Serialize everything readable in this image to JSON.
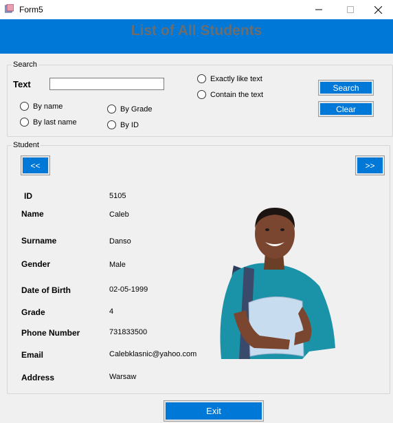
{
  "window": {
    "title": "Form5"
  },
  "header": {
    "title": "List of All Students"
  },
  "search": {
    "group_label": "Search",
    "text_label": "Text",
    "text_value": "",
    "options": {
      "by_name": "By name",
      "by_last_name": "By last name",
      "by_grade": "By Grade",
      "by_id": "By ID",
      "exactly": "Exactly like text",
      "contains": "Contain the text"
    },
    "search_label": "Search",
    "clear_label": "Clear"
  },
  "student": {
    "group_label": "Student",
    "prev_label": "<<",
    "next_label": ">>",
    "fields": {
      "id": {
        "label": "ID",
        "value": "5105"
      },
      "name": {
        "label": "Name",
        "value": "Caleb"
      },
      "surname": {
        "label": "Surname",
        "value": "Danso"
      },
      "gender": {
        "label": "Gender",
        "value": "Male"
      },
      "dob": {
        "label": "Date of Birth",
        "value": "02-05-1999"
      },
      "grade": {
        "label": "Grade",
        "value": "4"
      },
      "phone": {
        "label": "Phone Number",
        "value": "731833500"
      },
      "email": {
        "label": "Email",
        "value": "Calebklasnic@yahoo.com"
      },
      "address": {
        "label": "Address",
        "value": "Warsaw"
      }
    }
  },
  "exit_label": "Exit",
  "colors": {
    "accent": "#0078d7",
    "background": "#f0f0f0",
    "header_text": "#6d6d6d"
  },
  "icons": [
    "app-icon",
    "minimize-icon",
    "maximize-icon",
    "close-icon"
  ]
}
